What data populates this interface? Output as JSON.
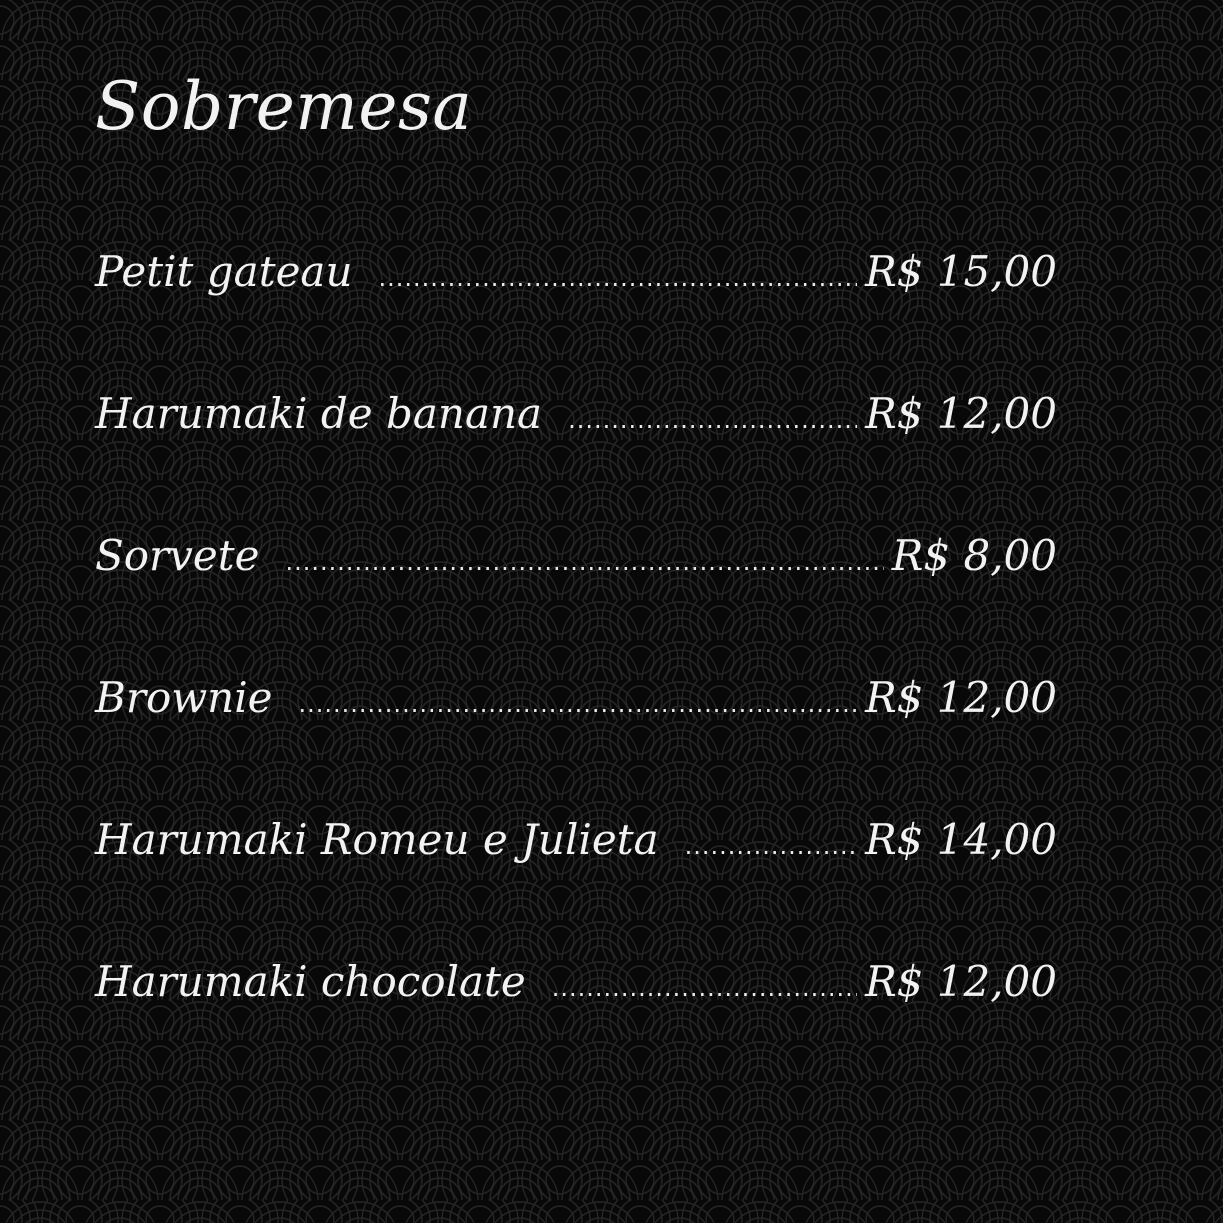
{
  "title": "Sobremesa",
  "items": [
    {
      "name": "Petit gateau",
      "price": "R$ 15,00"
    },
    {
      "name": "Harumaki de banana",
      "price": "R$ 12,00"
    },
    {
      "name": "Sorvete",
      "price": "R$ 8,00"
    },
    {
      "name": "Brownie",
      "price": "R$ 12,00"
    },
    {
      "name": "Harumaki Romeu e Julieta",
      "price": "R$ 14,00"
    },
    {
      "name": "Harumaki chocolate",
      "price": "R$ 12,00"
    }
  ],
  "colors": {
    "background": "#080808",
    "text": "#f2f2f2",
    "pattern": "#262626"
  }
}
